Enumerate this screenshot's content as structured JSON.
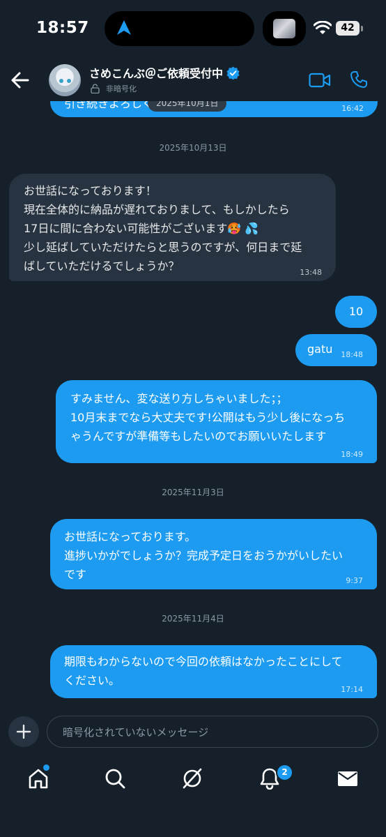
{
  "status": {
    "time": "18:57",
    "battery": "42"
  },
  "header": {
    "name": "さめこんぶ＠ご依頼受付中",
    "subtitle": "非暗号化"
  },
  "chat": {
    "top_partial": {
      "text": "引き続きよろしくお願いします！",
      "time": "16:42",
      "date_chip": "2025年10月1日"
    },
    "dates": [
      "2025年10月13日",
      "2025年11月3日",
      "2025年11月4日"
    ],
    "messages": [
      {
        "dir": "in",
        "text": "お世話になっております！\n現在全体的に納品が遅れておりまして、もしかしたら\n17日に間に合わない可能性がございます🥵 💦\n少し延ばしていただけたらと思うのですが、何日まで延\nばしていただけるでしょうか？",
        "time": "13:48"
      },
      {
        "dir": "out",
        "text": "10",
        "time": ""
      },
      {
        "dir": "out",
        "text": "gatu",
        "time": "18:48"
      },
      {
        "dir": "out",
        "text": "すみません、変な送り方しちゃいました；；\n10月末までなら大丈夫です!公開はもう少し後になっち\nゃうんですが準備等もしたいのでお願いいたします",
        "time": "18:49"
      },
      {
        "dir": "out",
        "text": "お世話になっております。\n進捗いかがでしょうか？完成予定日をおうかがいしたい\nです",
        "time": "9:37"
      },
      {
        "dir": "out",
        "text": "期限もわからないので今回の依頼はなかったことにして\nください。",
        "time": "17:14"
      }
    ]
  },
  "composer": {
    "placeholder": "暗号化されていないメッセージ"
  },
  "tabbar": {
    "notifications_badge": "2"
  },
  "colors": {
    "background": "#15202b",
    "outgoing_bubble": "#1d9bf0",
    "incoming_bubble": "#273340",
    "accent": "#1d9bf0"
  },
  "icons": [
    "arrow-left-icon",
    "verified-icon",
    "lock-icon",
    "video-icon",
    "phone-icon",
    "plus-icon",
    "home-icon",
    "search-icon",
    "grok-icon",
    "bell-icon",
    "mail-icon",
    "location-arrow-icon",
    "wifi-icon"
  ]
}
